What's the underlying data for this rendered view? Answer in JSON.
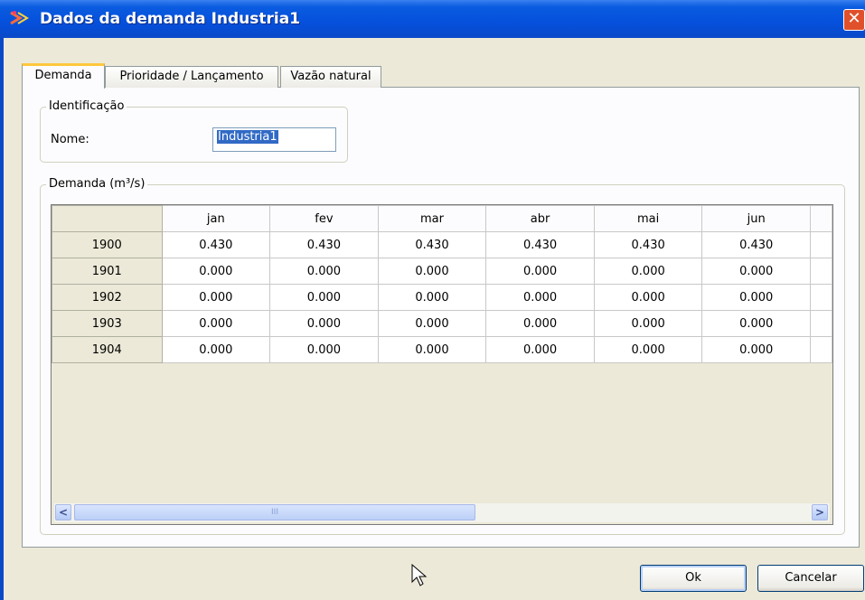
{
  "window": {
    "title": "Dados da demanda Industria1",
    "close_label": "✕"
  },
  "tabs": [
    {
      "label": "Demanda",
      "active": true
    },
    {
      "label": "Prioridade / Lançamento",
      "active": false
    },
    {
      "label": "Vazão natural",
      "active": false
    }
  ],
  "identification": {
    "legend": "Identificação",
    "name_label": "Nome:",
    "name_value": "Industria1"
  },
  "demand": {
    "legend": "Demanda (m³/s)",
    "columns": [
      "jan",
      "fev",
      "mar",
      "abr",
      "mai",
      "jun"
    ],
    "rows": [
      {
        "year": "1900",
        "values": [
          "0.430",
          "0.430",
          "0.430",
          "0.430",
          "0.430",
          "0.430"
        ]
      },
      {
        "year": "1901",
        "values": [
          "0.000",
          "0.000",
          "0.000",
          "0.000",
          "0.000",
          "0.000"
        ]
      },
      {
        "year": "1902",
        "values": [
          "0.000",
          "0.000",
          "0.000",
          "0.000",
          "0.000",
          "0.000"
        ]
      },
      {
        "year": "1903",
        "values": [
          "0.000",
          "0.000",
          "0.000",
          "0.000",
          "0.000",
          "0.000"
        ]
      },
      {
        "year": "1904",
        "values": [
          "0.000",
          "0.000",
          "0.000",
          "0.000",
          "0.000",
          "0.000"
        ]
      }
    ],
    "scroll_thumb_label": "III",
    "scroll_left": "<",
    "scroll_right": ">"
  },
  "buttons": {
    "ok": "Ok",
    "cancel": "Cancelar"
  }
}
